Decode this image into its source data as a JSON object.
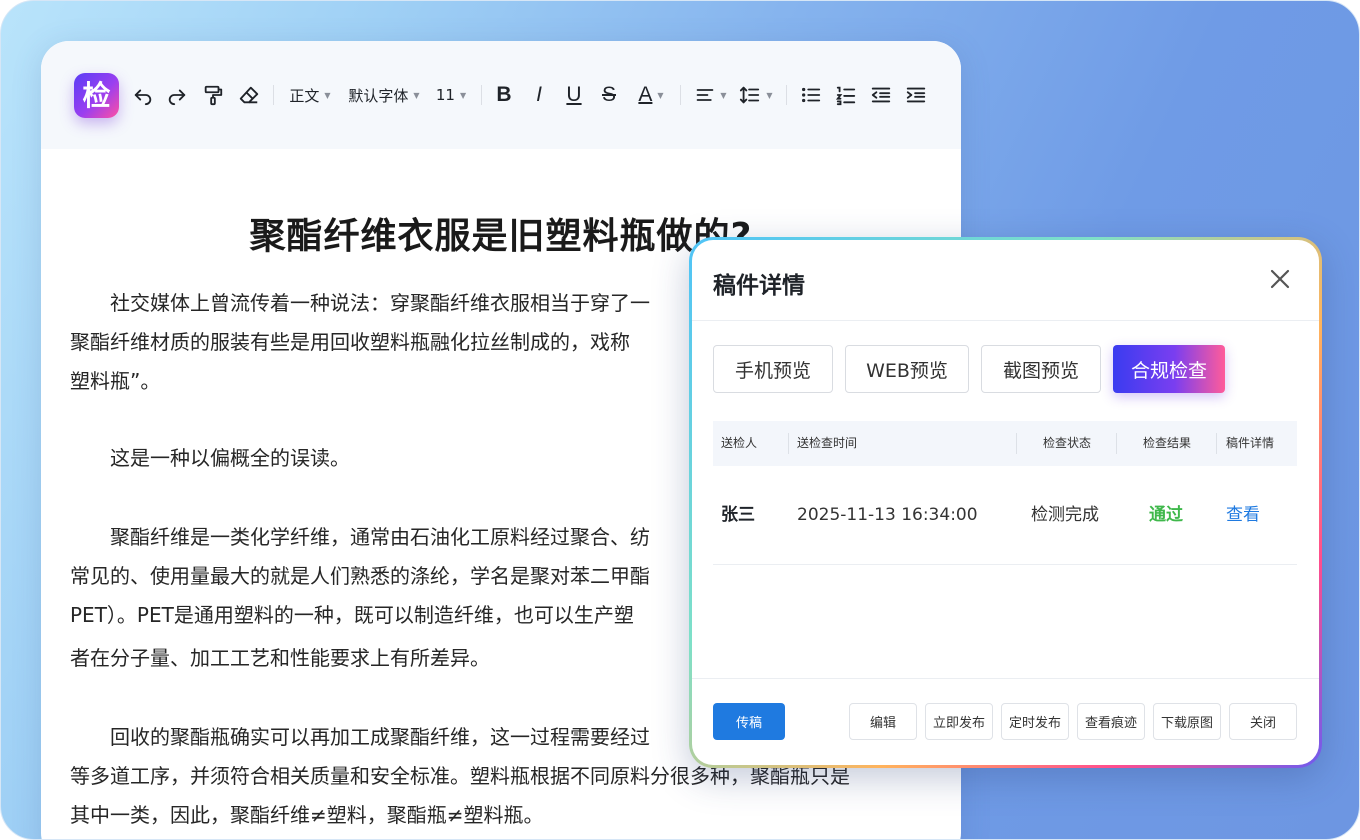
{
  "logo": {
    "char": "检"
  },
  "toolbar": {
    "paragraph_style": "正文",
    "font_family": "默认字体",
    "font_size": "11",
    "bold": "B",
    "italic": "I",
    "underline": "U",
    "strikethrough": "S",
    "font_color": "A",
    "icons": [
      "undo-icon",
      "redo-icon",
      "format-painter-icon",
      "eraser-icon",
      "align-left-icon",
      "line-height-icon",
      "bullet-list-icon",
      "numbered-list-icon",
      "outdent-icon",
      "indent-icon"
    ]
  },
  "document": {
    "title": "聚酯纤维衣服是旧塑料瓶做的?",
    "lines": [
      "社交媒体上曾流传着一种说法：穿聚酯纤维衣服相当于穿了一",
      "聚酯纤维材质的服装有些是用回收塑料瓶融化拉丝制成的，戏称",
      "塑料瓶”。",
      "这是一种以偏概全的误读。",
      "聚酯纤维是一类化学纤维，通常由石油化工原料经过聚合、纺",
      "常见的、使用量最大的就是人们熟悉的涤纶，学名是聚对苯二甲酯",
      "PET）。PET是通用塑料的一种，既可以制造纤维，也可以生产塑",
      "者在分子量、加工工艺和性能要求上有所差异。",
      "回收的聚酯瓶确实可以再加工成聚酯纤维，这一过程需要经过",
      "等多道工序，并须符合相关质量和安全标准。塑料瓶根据不同原料分很多种，聚酯瓶只是",
      "其中一类，因此，聚酯纤维≠塑料，聚酯瓶≠塑料瓶。"
    ]
  },
  "modal": {
    "title": "稿件详情",
    "tabs": [
      {
        "label": "手机预览"
      },
      {
        "label": "WEB预览"
      },
      {
        "label": "截图预览"
      },
      {
        "label": "合规检查"
      }
    ],
    "active_tab": "合规检查",
    "table": {
      "headers": [
        "送检人",
        "送检查时间",
        "检查状态",
        "检查结果",
        "稿件详情"
      ],
      "rows": [
        {
          "sender": "张三",
          "time": "2025-11-13 16:34:00",
          "status": "检测完成",
          "result": "通过",
          "detail": "查看"
        }
      ]
    },
    "footer": {
      "submit": "传稿",
      "edit": "编辑",
      "publish_now": "立即发布",
      "schedule": "定时发布",
      "view_trace": "查看痕迹",
      "download": "下载原图",
      "close": "关闭"
    }
  },
  "colors": {
    "primary": "#1f7ae0",
    "pass_green": "#3fb84b",
    "accent_gradient_start": "#3a3cf0",
    "accent_gradient_end": "#ff5c9a"
  }
}
